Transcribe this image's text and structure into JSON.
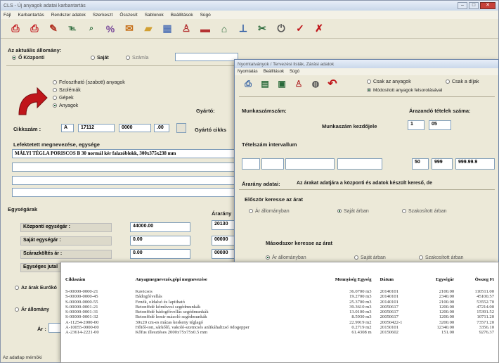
{
  "main": {
    "title": "CLS - Új anyagok adatai karbantartás",
    "menu": [
      "Fájl",
      "Karbantartás",
      "Rendszer adatok",
      "Szerkeszt",
      "Összesít",
      "Sablonok",
      "Beállítások",
      "Súgó"
    ],
    "section_title": "Az aktuális állomány:",
    "radio_central": "Ő Központi",
    "radio_own": "Saját",
    "radio_other": "Számla",
    "type_options": [
      "Felosztható (szabott) anyagok",
      "Szolémák",
      "Gépek",
      "Anyagok"
    ],
    "type_selected_index": 3,
    "label_manufacturer": "Gyártó:",
    "label_code": "Cikkszám :",
    "code_prefix": "A",
    "code_part1": "17112",
    "code_part2": "0000",
    "code_part3": ".00",
    "label_manufacturer_code": "Gyártó cikks",
    "label_description": "Lefektetett megnevezése, egysége",
    "description": "MÁLYI TÉGLA PORISCOS B 30 normál kér falazóblokk, 300x375x238 mm",
    "section_prices": "Egységárak",
    "label_price_col": "Árarány",
    "price_rows": [
      {
        "label": "Központi egységár :",
        "value": "44000.00",
        "extra": "20130"
      },
      {
        "label": "Saját egységár :",
        "value": "0.00",
        "extra": "00000"
      },
      {
        "label": "Szárazköltés ár :",
        "value": "0.00",
        "extra": "00000"
      },
      {
        "label": "Egységes jutal",
        "value": "",
        "extra": ""
      }
    ],
    "check_daily": "Az árak Eurókó",
    "check_file": "Ár állomány",
    "label_ar": "Ár :",
    "status": "Az adatlap mérnöki"
  },
  "dialog": {
    "title": "Nyomtatványok / Tervezési listák, Zárási adatok",
    "menu": [
      "Nyomtatás",
      "Beállítások",
      "Súgó"
    ],
    "radio_central_materials": "Csak az anyagok",
    "radio_only_prices": "Csak a díjak",
    "radio_modified": "Módosított anyagok felsorolásával",
    "label_material_code": "Munkaszámszám:",
    "label_code_count": "Árazandó tételek száma:",
    "label_material_start": "Munkaszám kezdőjele",
    "material_start_value": "1",
    "material_start_value2": "05",
    "label_interval": "Tételszám intervallum",
    "range_from": "50",
    "range_mid": "999",
    "range_to": "999.99.9",
    "label_price_data": "Árarány adatai:",
    "price_note": "Az árakat adatjára a központi és adatok készült kereső, de",
    "label_first_order": "Először keresse az árat",
    "label_second_order": "Másodszor keresse az árat",
    "options": [
      "Ár állományban",
      "Saját árban",
      "Szakosított árban"
    ]
  },
  "list": {
    "columns": [
      "Cikkszám",
      "Anyagmegnevezés,gépi megnevezése",
      "Mennyiség Egység",
      "Dátum",
      "Egységár",
      "Összeg Ft"
    ],
    "rows": [
      [
        "S-00000-0000-21",
        "Kavicsos",
        "36.0700 m3",
        "20140101",
        "2100.00",
        "110511.00"
      ],
      [
        "S-00000-0000-45",
        "Bádogfóvellás",
        "19.2700 m3",
        "20140101",
        "2340.00",
        "45100.57"
      ],
      [
        "S-00000-0000-55",
        "Fenék, oldalsó és lapitható",
        "25.3700 m3",
        "20140101",
        "2100.00",
        "53552.70"
      ],
      [
        "S-00000-0001-21",
        "Betonfödé kőművesi segédmunkák",
        "39.3610 m3",
        "20050617",
        "1200.00",
        "47214.00"
      ],
      [
        "S-00000-0001-31",
        "Betonfödé bádogfóvellás segédmunkák",
        "13.0100 m3",
        "20050617",
        "1200.00",
        "15391.52"
      ],
      [
        "S-00000-0001-32",
        "Betonfödé lemir mázoló segédmunkák",
        "8.5930 m3",
        "20050617",
        "1200.00",
        "10711.20"
      ],
      [
        "A-11254-2000-00",
        "30x20 cm-es mázas keskeny téglagó",
        "22.9919 m2",
        "20050422-1",
        "3200.00",
        "73571.20"
      ],
      [
        "A-10055-0000-00",
        "Hőtől-ion, sárkőlő, vakoló-szemcsés anlikáhaltzsó ödogepper",
        "0.2719 m2",
        "20150101",
        "12340.00",
        "3356.10"
      ],
      [
        "A-23614-2221-00",
        "Kőfus illesztéses 2000x75x75x0.5 mm",
        "61.4308 m",
        "20150602",
        "151.00",
        "9276.37"
      ]
    ]
  },
  "colors": {
    "accent_red": "#c0161b",
    "window_bg": "#ece9d8",
    "title_gradient_top": "#e7eef8"
  },
  "icons": [
    "print-icon",
    "print-preview-icon",
    "edit-icon",
    "code-icon",
    "search-code-icon",
    "percent-icon",
    "gift-icon",
    "folder-icon",
    "calculator-icon",
    "person-icon",
    "book-icon",
    "warehouse-icon",
    "chart-icon",
    "tools-icon",
    "power-icon",
    "check-icon",
    "cancel-icon"
  ]
}
